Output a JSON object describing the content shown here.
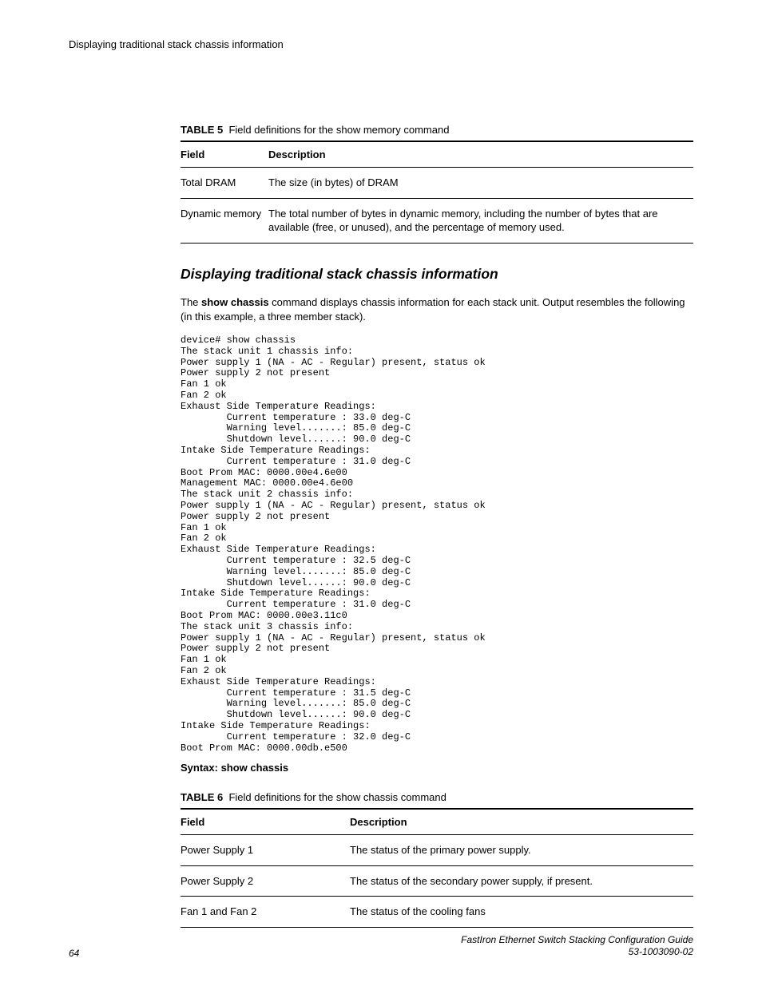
{
  "header": {
    "running_title": "Displaying traditional stack chassis information"
  },
  "table5": {
    "caption_prefix": "TABLE 5",
    "caption_text": "Field definitions for the show memory command",
    "col1_header": "Field",
    "col2_header": "Description",
    "rows": [
      {
        "field": "Total DRAM",
        "desc": "The size (in bytes) of DRAM"
      },
      {
        "field": "Dynamic memory",
        "desc": "The total number of bytes in dynamic memory, including the number of bytes that are available (free, or unused), and the percentage of memory used."
      }
    ]
  },
  "section": {
    "heading": "Displaying traditional stack chassis information",
    "para_prefix": "The ",
    "para_cmd": "show chassis",
    "para_suffix": " command displays chassis information for each stack unit. Output resembles the following (in this example, a three member stack)."
  },
  "codeblock": "device# show chassis\nThe stack unit 1 chassis info:\nPower supply 1 (NA - AC - Regular) present, status ok\nPower supply 2 not present\nFan 1 ok\nFan 2 ok\nExhaust Side Temperature Readings:\n        Current temperature : 33.0 deg-C\n        Warning level.......: 85.0 deg-C\n        Shutdown level......: 90.0 deg-C\nIntake Side Temperature Readings:\n        Current temperature : 31.0 deg-C\nBoot Prom MAC: 0000.00e4.6e00\nManagement MAC: 0000.00e4.6e00\nThe stack unit 2 chassis info:\nPower supply 1 (NA - AC - Regular) present, status ok\nPower supply 2 not present\nFan 1 ok\nFan 2 ok\nExhaust Side Temperature Readings:\n        Current temperature : 32.5 deg-C\n        Warning level.......: 85.0 deg-C\n        Shutdown level......: 90.0 deg-C\nIntake Side Temperature Readings:\n        Current temperature : 31.0 deg-C\nBoot Prom MAC: 0000.00e3.11c0\nThe stack unit 3 chassis info:\nPower supply 1 (NA - AC - Regular) present, status ok\nPower supply 2 not present\nFan 1 ok\nFan 2 ok\nExhaust Side Temperature Readings:\n        Current temperature : 31.5 deg-C\n        Warning level.......: 85.0 deg-C\n        Shutdown level......: 90.0 deg-C\nIntake Side Temperature Readings:\n        Current temperature : 32.0 deg-C\nBoot Prom MAC: 0000.00db.e500",
  "syntax": "Syntax: show chassis",
  "table6": {
    "caption_prefix": "TABLE 6",
    "caption_text": "Field definitions for the show chassis command",
    "col1_header": "Field",
    "col2_header": "Description",
    "rows": [
      {
        "field": "Power Supply 1",
        "desc": "The status of the primary power supply."
      },
      {
        "field": "Power Supply 2",
        "desc": "The status of the secondary power supply, if present."
      },
      {
        "field": "Fan 1 and Fan 2",
        "desc": "The status of the cooling fans"
      }
    ]
  },
  "footer": {
    "page_number": "64",
    "doc_title_line1": "FastIron Ethernet Switch Stacking Configuration Guide",
    "doc_title_line2": "53-1003090-02"
  }
}
